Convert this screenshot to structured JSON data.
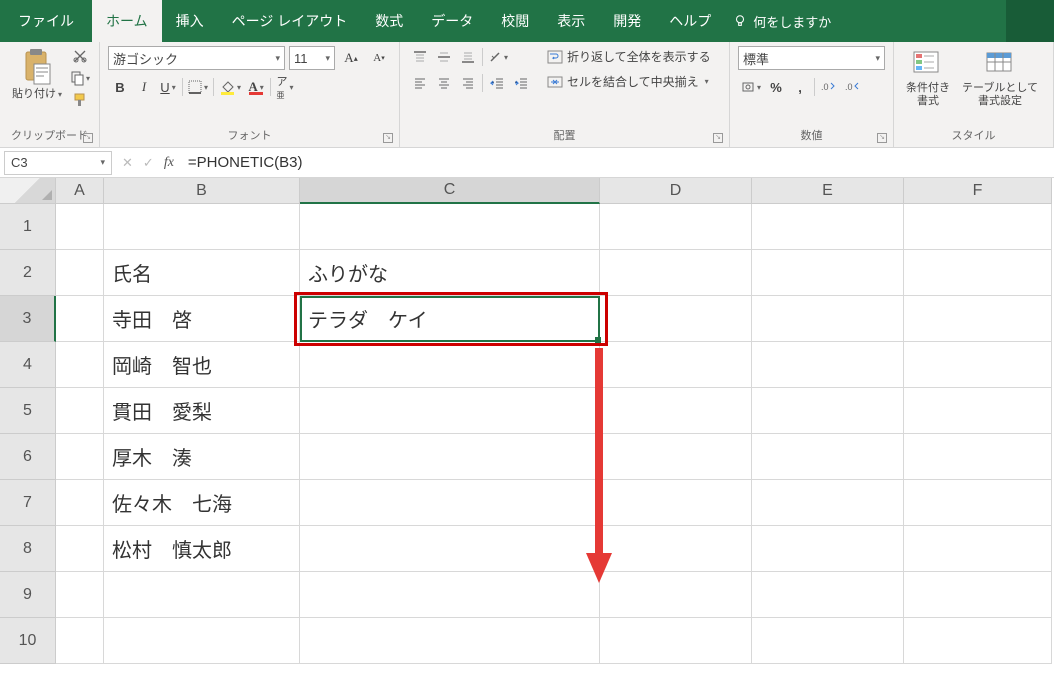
{
  "tabs": {
    "file": "ファイル",
    "home": "ホーム",
    "insert": "挿入",
    "page": "ページ レイアウト",
    "formulas": "数式",
    "data": "データ",
    "review": "校閲",
    "view": "表示",
    "dev": "開発",
    "help": "ヘルプ",
    "tell_me": "何をしますか"
  },
  "ribbon": {
    "clipboard": {
      "paste": "貼り付け",
      "group": "クリップボード"
    },
    "font": {
      "name": "游ゴシック",
      "size": "11",
      "group": "フォント"
    },
    "alignment": {
      "wrap": "折り返して全体を表示する",
      "merge": "セルを結合して中央揃え",
      "group": "配置"
    },
    "number": {
      "format": "標準",
      "group": "数値",
      "comma": ","
    },
    "styles": {
      "cond": "条件付き\n書式",
      "table": "テーブルとして\n書式設定",
      "group": "スタイル"
    }
  },
  "namebox": "C3",
  "formula": "=PHONETIC(B3)",
  "columns": [
    "A",
    "B",
    "C",
    "D",
    "E",
    "F"
  ],
  "rows": [
    "1",
    "2",
    "3",
    "4",
    "5",
    "6",
    "7",
    "8",
    "9",
    "10"
  ],
  "cells": {
    "B2": "氏名",
    "C2": "ふりがな",
    "B3": "寺田　啓",
    "C3": "テラダ　ケイ",
    "B4": "岡崎　智也",
    "B5": "貫田　愛梨",
    "B6": "厚木　湊",
    "B7": "佐々木　七海",
    "B8": "松村　慎太郎"
  },
  "selected": {
    "cell": "C3",
    "row": "3",
    "col": "C"
  }
}
